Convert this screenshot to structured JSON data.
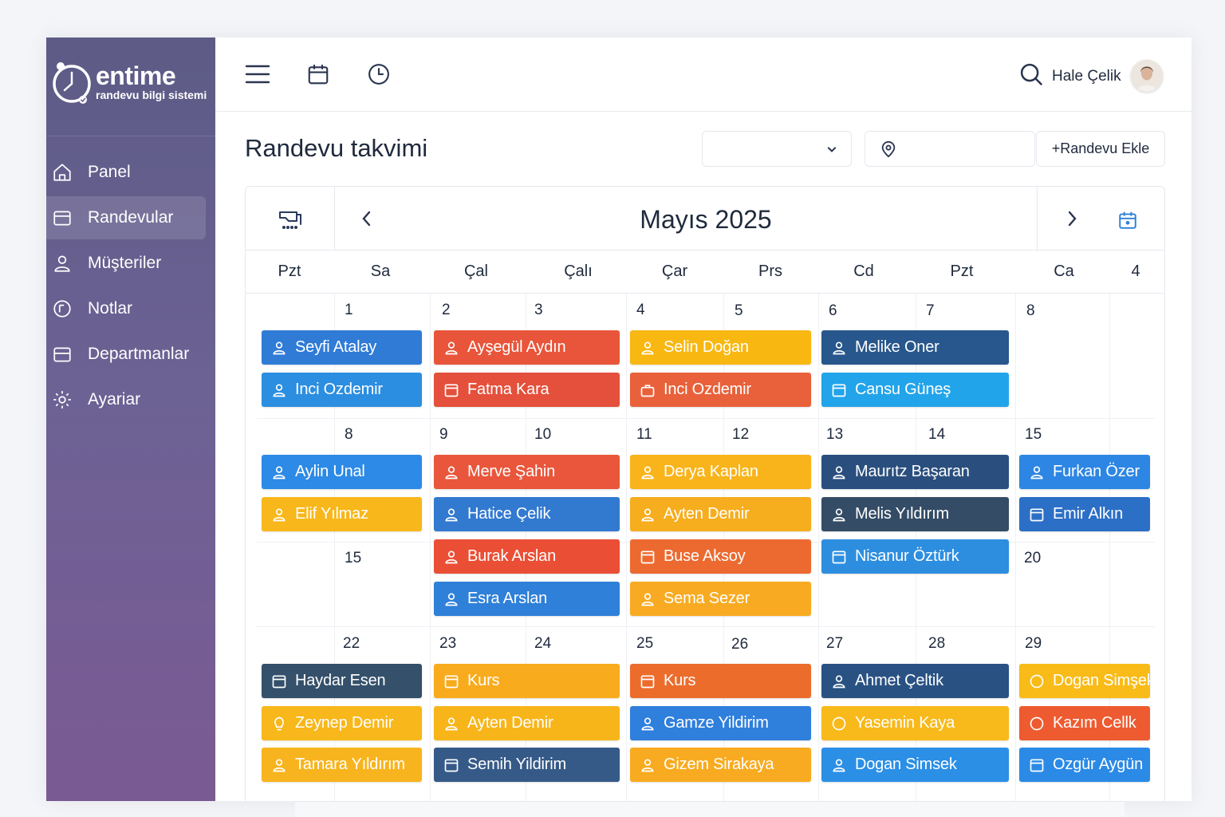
{
  "brand": {
    "name": "entime",
    "subtitle": "randevu bilgi sistemi"
  },
  "sidebar": {
    "items": [
      {
        "label": "Panel",
        "icon": "home-icon",
        "active": false
      },
      {
        "label": "Randevular",
        "icon": "calendar-icon",
        "active": true
      },
      {
        "label": "Müşteriler",
        "icon": "user-icon",
        "active": false
      },
      {
        "label": "Notlar",
        "icon": "note-icon",
        "active": false
      },
      {
        "label": "Departmanlar",
        "icon": "folder-icon",
        "active": false
      },
      {
        "label": "Ayariar",
        "icon": "gear-icon",
        "active": false
      }
    ]
  },
  "topbar": {
    "user_name": "Hale Çelik"
  },
  "page": {
    "title": "Randevu takvimi",
    "add_button": "+Randevu Ekle",
    "select_placeholder": ""
  },
  "calendar": {
    "month_title": "Mayıs 2025",
    "weekdays": [
      "Pzt",
      "Sa",
      "Çal",
      "Çalı",
      "Çar",
      "Prs",
      "Cd",
      "Pzt",
      "Ca",
      "4"
    ],
    "day_numbers": [
      "1",
      "2",
      "3",
      "4",
      "5",
      "6",
      "7",
      "8",
      "8",
      "9",
      "10",
      "11",
      "12",
      "13",
      "14",
      "15",
      "15",
      "20",
      "22",
      "23",
      "24",
      "25",
      "26",
      "27",
      "28",
      "29"
    ],
    "events": [
      {
        "label": "Seyfi Atalay",
        "color": "#2f7bd6",
        "icon": "user-icon"
      },
      {
        "label": "Inci Ozdemir",
        "color": "#2b8ee0",
        "icon": "user-icon"
      },
      {
        "label": "Ayşegül Aydın",
        "color": "#e8553a",
        "icon": "user-icon"
      },
      {
        "label": "Fatma Kara",
        "color": "#e4503b",
        "icon": "calendar-icon"
      },
      {
        "label": "Selin Doğan",
        "color": "#f8b711",
        "icon": "user-icon"
      },
      {
        "label": "Inci Ozdemir",
        "color": "#e8613a",
        "icon": "briefcase-icon"
      },
      {
        "label": "Melike Oner",
        "color": "#27578c",
        "icon": "user-icon"
      },
      {
        "label": "Cansu Güneş",
        "color": "#22a4ea",
        "icon": "calendar-icon"
      },
      {
        "label": "Aylin Unal",
        "color": "#2d8ae6",
        "icon": "user-icon"
      },
      {
        "label": "Elif Yılmaz",
        "color": "#f8b71a",
        "icon": "user-icon"
      },
      {
        "label": "Merve Şahin",
        "color": "#e9563b",
        "icon": "user-icon"
      },
      {
        "label": "Hatice Çelik",
        "color": "#3279d0",
        "icon": "user-icon"
      },
      {
        "label": "Burak Arslan",
        "color": "#ea4f36",
        "icon": "user-icon"
      },
      {
        "label": "Esra Arslan",
        "color": "#2f80d8",
        "icon": "user-icon"
      },
      {
        "label": "Derya Kaplan",
        "color": "#f8b41a",
        "icon": "user-icon"
      },
      {
        "label": "Ayten Demir",
        "color": "#f6ad1e",
        "icon": "user-icon"
      },
      {
        "label": "Buse Aksoy",
        "color": "#ec6a30",
        "icon": "calendar-icon"
      },
      {
        "label": "Sema Sezer",
        "color": "#f8ab22",
        "icon": "user-icon"
      },
      {
        "label": "Maurıtz Başaran",
        "color": "#2a4f7e",
        "icon": "user-icon"
      },
      {
        "label": "Melis Yıldırım",
        "color": "#344c66",
        "icon": "user-icon"
      },
      {
        "label": "Nisanur Öztürk",
        "color": "#2d8ee0",
        "icon": "calendar-icon"
      },
      {
        "label": "Furkan Özer",
        "color": "#2d86e3",
        "icon": "user-icon"
      },
      {
        "label": "Emir Alkın",
        "color": "#2c6fc6",
        "icon": "calendar-icon"
      },
      {
        "label": "Haydar Esen",
        "color": "#34506a",
        "icon": "calendar-icon"
      },
      {
        "label": "Zeynep Demir",
        "color": "#f8b71a",
        "icon": "bulb-icon"
      },
      {
        "label": "Tamara Yıldırım",
        "color": "#f8b41e",
        "icon": "user-icon"
      },
      {
        "label": "Kurs",
        "color": "#f8ab1c",
        "icon": "calendar-icon"
      },
      {
        "label": "Ayten Demir",
        "color": "#f8b51a",
        "icon": "user-icon"
      },
      {
        "label": "Semih Yildirim",
        "color": "#365a88",
        "icon": "calendar-icon"
      },
      {
        "label": "Kurs",
        "color": "#ec6c2c",
        "icon": "calendar-icon"
      },
      {
        "label": "Gamze Yildirim",
        "color": "#2f7fdc",
        "icon": "user-icon"
      },
      {
        "label": "Gizem Sirakaya",
        "color": "#f8ab20",
        "icon": "user-icon"
      },
      {
        "label": "Ahmet Çeltik",
        "color": "#295283",
        "icon": "user-icon"
      },
      {
        "label": "Yasemin Kaya",
        "color": "#f8b91a",
        "icon": "circle-icon"
      },
      {
        "label": "Dogan Simsek",
        "color": "#2b8fe6",
        "icon": "user-icon"
      },
      {
        "label": "Dogan Simşek",
        "color": "#f8bb18",
        "icon": "circle-icon"
      },
      {
        "label": "Kazım Cellk",
        "color": "#ee5b30",
        "icon": "circle-icon"
      },
      {
        "label": "Ozgür Aygün",
        "color": "#2b8ae6",
        "icon": "calendar-icon"
      }
    ]
  }
}
